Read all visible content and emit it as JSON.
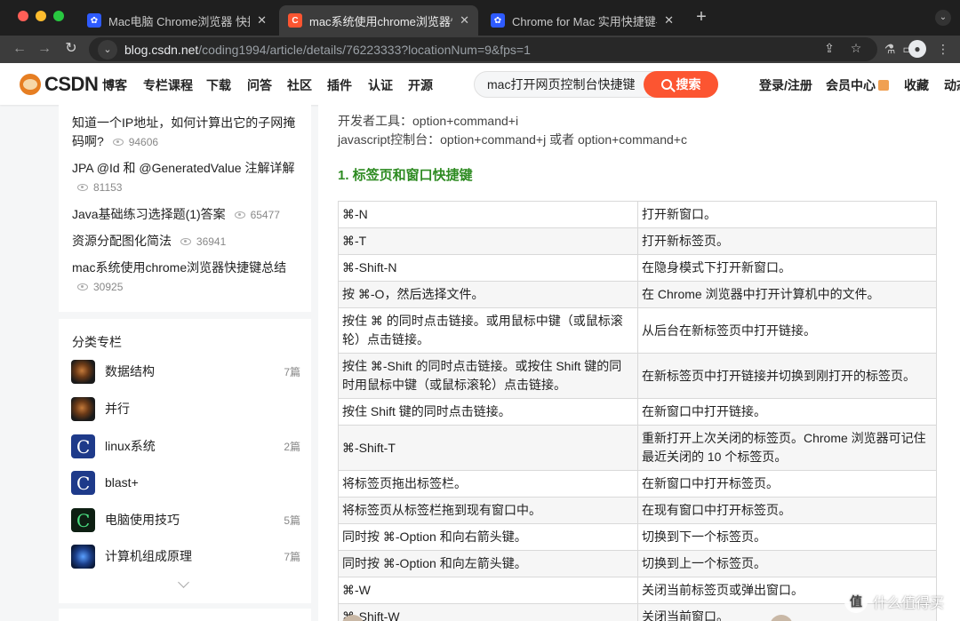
{
  "browser": {
    "tabs": [
      {
        "title": "Mac电脑 Chrome浏览器 快捷键",
        "favicon": "baidu-paw-icon",
        "active": false
      },
      {
        "title": "mac系统使用chrome浏览器快捷",
        "favicon": "csdn-c-icon",
        "active": true
      },
      {
        "title": "Chrome for Mac 实用快捷键-百",
        "favicon": "baidu-paw-icon",
        "active": false
      }
    ],
    "tab_close": "✕",
    "new_tab": "+",
    "tab_menu": "⌄",
    "url_host": "blog.csdn.net",
    "url_path": "/coding1994/article/details/76223333?locationNum=9&fps=1",
    "icons": {
      "back": "←",
      "forward": "→",
      "reload": "↻",
      "tune": "⌄",
      "share": "⇪",
      "bookmark": "☆",
      "extension": "⚗",
      "sidebar": "▭",
      "profile": "●",
      "menu": "⋮"
    }
  },
  "header": {
    "logo_text": "CSDN",
    "nav": [
      "博客",
      "专栏课程",
      "下载",
      "问答",
      "社区",
      "插件",
      "认证",
      "开源"
    ],
    "search_value": "mac打开网页控制台快捷键",
    "search_button": "搜索",
    "login": "登录/注册",
    "member": "会员中心",
    "favorites": "收藏",
    "dynamic": "动态"
  },
  "hot_articles": [
    {
      "title": "知道一个IP地址，如何计算出它的子网掩码啊?",
      "views": "94606"
    },
    {
      "title": "JPA @Id 和 @GeneratedValue 注解详解",
      "views": "81153"
    },
    {
      "title": "Java基础练习选择题(1)答案",
      "views": "65477"
    },
    {
      "title": "资源分配图化简法",
      "views": "36941"
    },
    {
      "title": "mac系统使用chrome浏览器快捷键总结",
      "views": "30925"
    }
  ],
  "categories": {
    "heading": "分类专栏",
    "items": [
      {
        "name": "数据结构",
        "count": "7篇",
        "thumb": "planet"
      },
      {
        "name": "并行",
        "count": "",
        "thumb": "planet"
      },
      {
        "name": "linux系统",
        "count": "2篇",
        "thumb": "clogo"
      },
      {
        "name": "blast+",
        "count": "",
        "thumb": "clogo"
      },
      {
        "name": "电脑使用技巧",
        "count": "5篇",
        "thumb": "cgreen"
      },
      {
        "name": "计算机组成原理",
        "count": "7篇",
        "thumb": "swirl"
      }
    ]
  },
  "article": {
    "devtools_line": "开发者工具：option+command+i",
    "console_line": "javascript控制台：option+command+j 或者 option+command+c",
    "section_heading": "1. 标签页和窗口快捷键",
    "shortcuts": [
      {
        "key": "⌘-N",
        "desc": "打开新窗口。"
      },
      {
        "key": "⌘-T",
        "desc": "打开新标签页。"
      },
      {
        "key": "⌘-Shift-N",
        "desc": "在隐身模式下打开新窗口。"
      },
      {
        "key": "按 ⌘-O，然后选择文件。",
        "desc": "在 Chrome 浏览器中打开计算机中的文件。"
      },
      {
        "key": "按住 ⌘ 的同时点击链接。或用鼠标中键（或鼠标滚轮）点击链接。",
        "desc": "从后台在新标签页中打开链接。"
      },
      {
        "key": "按住 ⌘-Shift 的同时点击链接。或按住 Shift 键的同时用鼠标中键（或鼠标滚轮）点击链接。",
        "desc": "在新标签页中打开链接并切换到刚打开的标签页。"
      },
      {
        "key": "按住 Shift 键的同时点击链接。",
        "desc": "在新窗口中打开链接。"
      },
      {
        "key": "⌘-Shift-T",
        "desc": "重新打开上次关闭的标签页。Chrome 浏览器可记住最近关闭的 10 个标签页。"
      },
      {
        "key": "将标签页拖出标签栏。",
        "desc": "在新窗口中打开标签页。"
      },
      {
        "key": "将标签页从标签栏拖到现有窗口中。",
        "desc": "在现有窗口中打开标签页。"
      },
      {
        "key": "同时按 ⌘-Option 和向右箭头键。",
        "desc": "切换到下一个标签页。"
      },
      {
        "key": "同时按 ⌘-Option 和向左箭头键。",
        "desc": "切换到上一个标签页。"
      },
      {
        "key": "⌘-W",
        "desc": "关闭当前标签页或弹出窗口。"
      },
      {
        "key": "⌘-Shift-W",
        "desc": "关闭当前窗口。"
      }
    ]
  },
  "watermark": {
    "symbol": "值",
    "text": "什么值得买"
  }
}
